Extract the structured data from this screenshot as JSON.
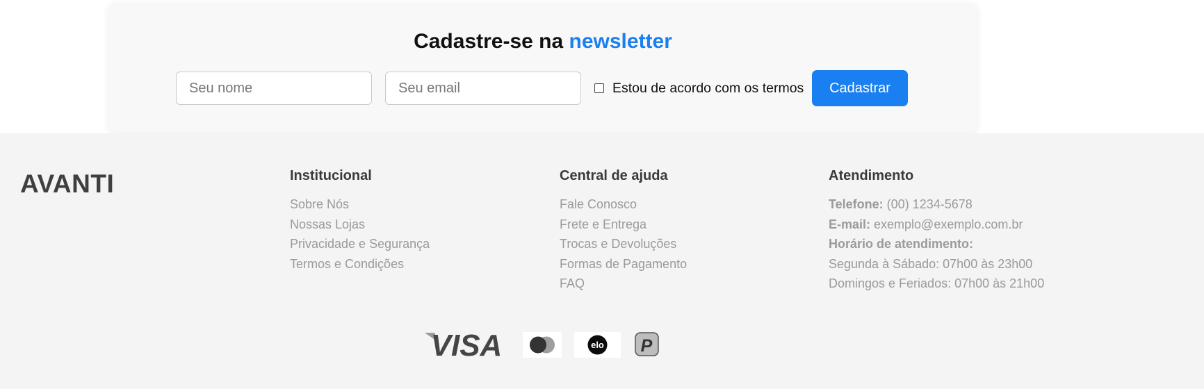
{
  "newsletter": {
    "title_prefix": "Cadastre-se na ",
    "title_highlight": "newsletter",
    "name_placeholder": "Seu nome",
    "email_placeholder": "Seu email",
    "terms_label": "Estou de acordo com os termos",
    "terms_checked": false,
    "submit_label": "Cadastrar",
    "accent_color": "#1a7ff0"
  },
  "footer": {
    "brand": "AVANTI",
    "institucional": {
      "title": "Institucional",
      "links": [
        "Sobre Nós",
        "Nossas Lojas",
        "Privacidade e Segurança",
        "Termos e Condições"
      ]
    },
    "ajuda": {
      "title": "Central de ajuda",
      "links": [
        "Fale Conosco",
        "Frete e Entrega",
        "Trocas e Devoluções",
        "Formas de Pagamento",
        "FAQ"
      ]
    },
    "atendimento": {
      "title": "Atendimento",
      "phone_label": "Telefone:",
      "phone_value": " (00) 1234-5678",
      "email_label": "E-mail:",
      "email_value": " exemplo@exemplo.com.br",
      "hours_label": "Horário de atendimento:",
      "hours_weekday": "Segunda à Sábado: 07h00 às 23h00",
      "hours_weekend": "Domingos e Feriados: 07h00 às 21h00"
    },
    "payments": {
      "visa_text": "VISA",
      "elo_text": "elo",
      "paypal_text": "P",
      "icons": [
        "visa-icon",
        "mastercard-icon",
        "elo-icon",
        "paypal-icon"
      ]
    }
  }
}
